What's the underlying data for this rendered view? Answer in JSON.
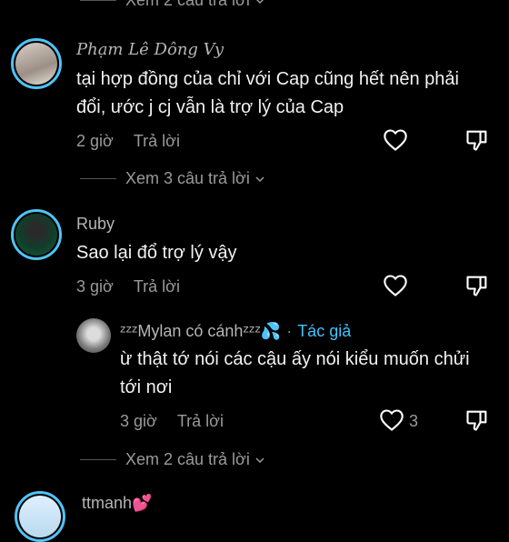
{
  "comments": [
    {
      "view_more_top": "Xem 2 câu trả lời",
      "name": "Phạm Lê Dông Vy",
      "text": "tại hợp đồng của chỉ với Cap cũng hết nên phải đổi, ước j cj vẫn là trợ lý của Cap",
      "time": "2 giờ",
      "reply": "Trả lời",
      "view_more": "Xem 3 câu trả lời"
    },
    {
      "name": "Ruby",
      "text": "Sao lại đổ trợ lý vậy",
      "time": "3 giờ",
      "reply": "Trả lời"
    }
  ],
  "reply_comment": {
    "name": "ᶻᶻᶻMylan có cánhᶻᶻᶻ💦",
    "separator": "·",
    "author_badge": "Tác giả",
    "text": "ừ thật tớ nói các cậu ấy nói kiểu muốn chửi tới nơi",
    "time": "3 giờ",
    "reply": "Trả lời",
    "likes": "3"
  },
  "view_more_bottom": "Xem 2 câu trả lời",
  "last_comment_name": "ttmanh💕",
  "colors": {
    "background": "#000000",
    "author_badge": "#3fc4ff",
    "avatar_ring": "#4fc3f7"
  },
  "icons": [
    "heart-outline-icon",
    "dislike-icon",
    "chevron-down-icon"
  ]
}
